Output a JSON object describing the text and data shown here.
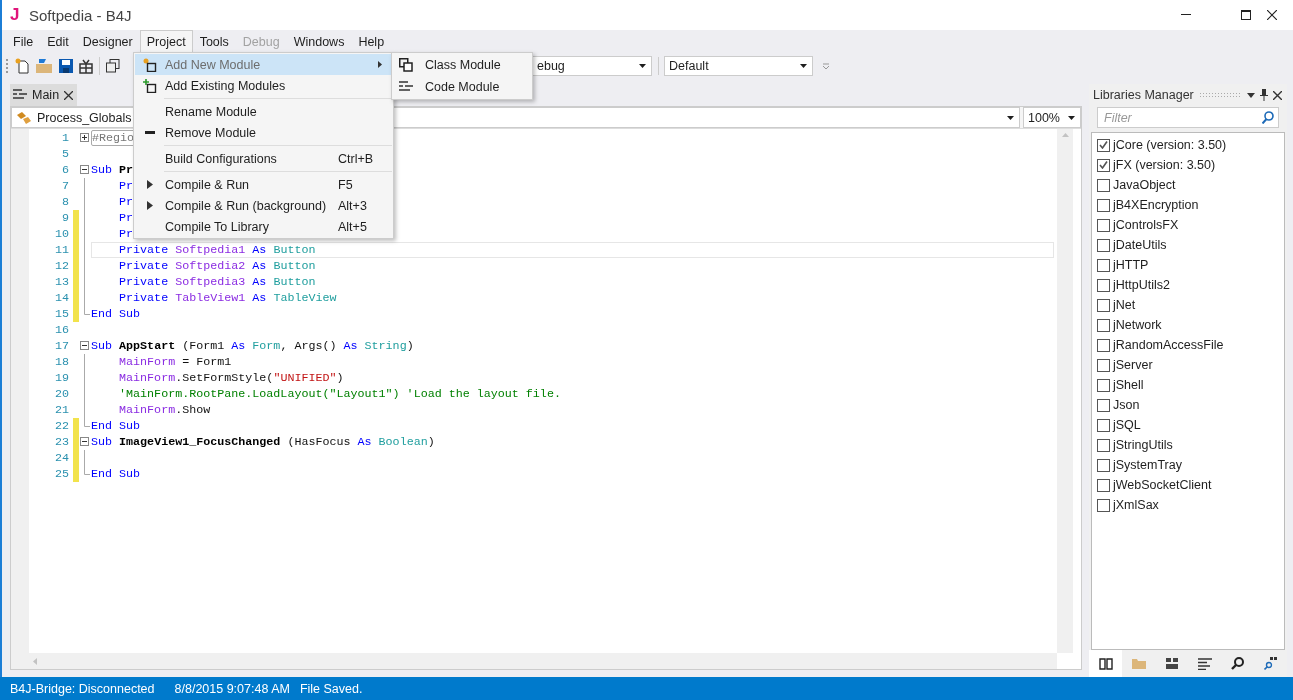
{
  "window": {
    "app_letter": "J",
    "title": "Softpedia - B4J"
  },
  "menu_bar": [
    {
      "label": "File",
      "selected": false,
      "disabled": false
    },
    {
      "label": "Edit",
      "selected": false,
      "disabled": false
    },
    {
      "label": "Designer",
      "selected": false,
      "disabled": false
    },
    {
      "label": "Project",
      "selected": true,
      "disabled": false
    },
    {
      "label": "Tools",
      "selected": false,
      "disabled": false
    },
    {
      "label": "Debug",
      "selected": false,
      "disabled": true
    },
    {
      "label": "Windows",
      "selected": false,
      "disabled": false
    },
    {
      "label": "Help",
      "selected": false,
      "disabled": false
    }
  ],
  "toolbar": {
    "build_combo": "ebug",
    "platform_combo": "Default"
  },
  "project_menu": [
    {
      "kind": "item",
      "label": "Add New Module",
      "selected": true,
      "has_submenu": true
    },
    {
      "kind": "item",
      "label": "Add Existing Modules",
      "selected": false,
      "has_submenu": false
    },
    {
      "kind": "separator"
    },
    {
      "kind": "item",
      "label": "Rename Module",
      "selected": false,
      "has_submenu": false
    },
    {
      "kind": "item",
      "label": "Remove Module",
      "selected": false,
      "has_submenu": false
    },
    {
      "kind": "separator"
    },
    {
      "kind": "item",
      "label": "Build Configurations",
      "shortcut": "Ctrl+B",
      "selected": false,
      "has_submenu": false
    },
    {
      "kind": "separator"
    },
    {
      "kind": "item",
      "label": "Compile & Run",
      "shortcut": "F5",
      "selected": false,
      "has_submenu": false
    },
    {
      "kind": "item",
      "label": "Compile & Run (background)",
      "shortcut": "Alt+3",
      "selected": false,
      "has_submenu": false
    },
    {
      "kind": "item",
      "label": "Compile To Library",
      "shortcut": "Alt+5",
      "selected": false,
      "has_submenu": false
    }
  ],
  "submenu": [
    {
      "label": "Class Module"
    },
    {
      "label": "Code Module"
    }
  ],
  "document_tabs": [
    {
      "label": "Main",
      "selected": true
    }
  ],
  "editor": {
    "module_combo": "Process_Globals",
    "zoom_combo": "100%",
    "lines": [
      {
        "number": "1",
        "changed": false,
        "current": false,
        "kind": "region",
        "tokens": [
          {
            "kind": "region",
            "text": "#Regio"
          }
        ]
      },
      {
        "number": "5",
        "changed": false,
        "current": false,
        "kind": "plain"
      },
      {
        "number": "6",
        "changed": false,
        "current": false,
        "kind": "start",
        "tokens": [
          {
            "kind": "keyword",
            "text": "Sub "
          },
          {
            "kind": "name",
            "text": "Pr"
          }
        ]
      },
      {
        "number": "7",
        "changed": false,
        "current": false,
        "kind": "plain",
        "tokens": [
          {
            "kind": "keyword",
            "text": "    Pr"
          }
        ]
      },
      {
        "number": "8",
        "changed": false,
        "current": false,
        "kind": "plain",
        "tokens": [
          {
            "kind": "keyword",
            "text": "    Pr"
          }
        ]
      },
      {
        "number": "9",
        "changed": true,
        "current": false,
        "kind": "plain",
        "tokens": [
          {
            "kind": "keyword",
            "text": "    Pr"
          }
        ]
      },
      {
        "number": "10",
        "changed": true,
        "current": false,
        "kind": "plain",
        "tokens": [
          {
            "kind": "keyword",
            "text": "    Pr"
          }
        ]
      },
      {
        "number": "11",
        "changed": true,
        "current": true,
        "kind": "plain",
        "tokens": [
          {
            "kind": "keyword",
            "text": "    Private "
          },
          {
            "kind": "variable",
            "text": "Softpedia1"
          },
          {
            "kind": "keyword",
            "text": " As "
          },
          {
            "kind": "type",
            "text": "Button"
          }
        ]
      },
      {
        "number": "12",
        "changed": true,
        "current": false,
        "kind": "plain",
        "tokens": [
          {
            "kind": "keyword",
            "text": "    Private "
          },
          {
            "kind": "variable",
            "text": "Softpedia2"
          },
          {
            "kind": "keyword",
            "text": " As "
          },
          {
            "kind": "type",
            "text": "Button"
          }
        ]
      },
      {
        "number": "13",
        "changed": true,
        "current": false,
        "kind": "plain",
        "tokens": [
          {
            "kind": "keyword",
            "text": "    Private "
          },
          {
            "kind": "variable",
            "text": "Softpedia3"
          },
          {
            "kind": "keyword",
            "text": " As "
          },
          {
            "kind": "type",
            "text": "Button"
          }
        ]
      },
      {
        "number": "14",
        "changed": true,
        "current": false,
        "kind": "plain",
        "tokens": [
          {
            "kind": "keyword",
            "text": "    Private "
          },
          {
            "kind": "variable",
            "text": "TableView1"
          },
          {
            "kind": "keyword",
            "text": " As "
          },
          {
            "kind": "type",
            "text": "TableView"
          }
        ]
      },
      {
        "number": "15",
        "changed": true,
        "current": false,
        "kind": "end",
        "tokens": [
          {
            "kind": "keyword",
            "text": "End Sub"
          }
        ]
      },
      {
        "number": "16",
        "changed": false,
        "current": false,
        "kind": "plain"
      },
      {
        "number": "17",
        "changed": false,
        "current": false,
        "kind": "start",
        "tokens": [
          {
            "kind": "keyword",
            "text": "Sub "
          },
          {
            "kind": "name",
            "text": "AppStart"
          },
          {
            "kind": "plain",
            "text": " (Form1 "
          },
          {
            "kind": "keyword",
            "text": "As "
          },
          {
            "kind": "type",
            "text": "Form"
          },
          {
            "kind": "plain",
            "text": ", Args() "
          },
          {
            "kind": "keyword",
            "text": "As "
          },
          {
            "kind": "type",
            "text": "String"
          },
          {
            "kind": "plain",
            "text": ")"
          }
        ]
      },
      {
        "number": "18",
        "changed": false,
        "current": false,
        "kind": "plain",
        "tokens": [
          {
            "kind": "variable",
            "text": "    MainForm"
          },
          {
            "kind": "plain",
            "text": " = Form1"
          }
        ]
      },
      {
        "number": "19",
        "changed": false,
        "current": false,
        "kind": "plain",
        "tokens": [
          {
            "kind": "variable",
            "text": "    MainForm"
          },
          {
            "kind": "plain",
            "text": ".SetFormStyle("
          },
          {
            "kind": "string",
            "text": "\"UNIFIED\""
          },
          {
            "kind": "plain",
            "text": ")"
          }
        ]
      },
      {
        "number": "20",
        "changed": false,
        "current": false,
        "kind": "plain",
        "tokens": [
          {
            "kind": "comment",
            "text": "    'MainForm.RootPane.LoadLayout(\"Layout1\") 'Load the layout file."
          }
        ]
      },
      {
        "number": "21",
        "changed": false,
        "current": false,
        "kind": "plain",
        "tokens": [
          {
            "kind": "variable",
            "text": "    MainForm"
          },
          {
            "kind": "plain",
            "text": ".Show"
          }
        ]
      },
      {
        "number": "22",
        "changed": true,
        "current": false,
        "kind": "end",
        "tokens": [
          {
            "kind": "keyword",
            "text": "End Sub"
          }
        ]
      },
      {
        "number": "23",
        "changed": true,
        "current": false,
        "kind": "start",
        "tokens": [
          {
            "kind": "keyword",
            "text": "Sub "
          },
          {
            "kind": "name",
            "text": "ImageView1_FocusChanged"
          },
          {
            "kind": "plain",
            "text": " (HasFocus "
          },
          {
            "kind": "keyword",
            "text": "As "
          },
          {
            "kind": "type",
            "text": "Boolean"
          },
          {
            "kind": "plain",
            "text": ")"
          }
        ]
      },
      {
        "number": "24",
        "changed": true,
        "current": false,
        "kind": "plain"
      },
      {
        "number": "25",
        "changed": true,
        "current": false,
        "kind": "end",
        "tokens": [
          {
            "kind": "keyword",
            "text": "End Sub"
          }
        ]
      }
    ]
  },
  "libraries_manager": {
    "title": "Libraries Manager",
    "filter": {
      "placeholder": "Filter"
    },
    "libraries": [
      {
        "name": "jCore (version: 3.50)",
        "checked": true
      },
      {
        "name": "jFX (version: 3.50)",
        "checked": true
      },
      {
        "name": "JavaObject",
        "checked": false
      },
      {
        "name": "jB4XEncryption",
        "checked": false
      },
      {
        "name": "jControlsFX",
        "checked": false
      },
      {
        "name": "jDateUtils",
        "checked": false
      },
      {
        "name": "jHTTP",
        "checked": false
      },
      {
        "name": "jHttpUtils2",
        "checked": false
      },
      {
        "name": "jNet",
        "checked": false
      },
      {
        "name": "jNetwork",
        "checked": false
      },
      {
        "name": "jRandomAccessFile",
        "checked": false
      },
      {
        "name": "jServer",
        "checked": false
      },
      {
        "name": "jShell",
        "checked": false
      },
      {
        "name": "Json",
        "checked": false
      },
      {
        "name": "jSQL",
        "checked": false
      },
      {
        "name": "jStringUtils",
        "checked": false
      },
      {
        "name": "jSystemTray",
        "checked": false
      },
      {
        "name": "jWebSocketClient",
        "checked": false
      },
      {
        "name": "jXmlSax",
        "checked": false
      }
    ]
  },
  "status_bar": [
    "B4J-Bridge: Disconnected",
    "8/8/2015 9:07:48 AM",
    "File Saved."
  ]
}
